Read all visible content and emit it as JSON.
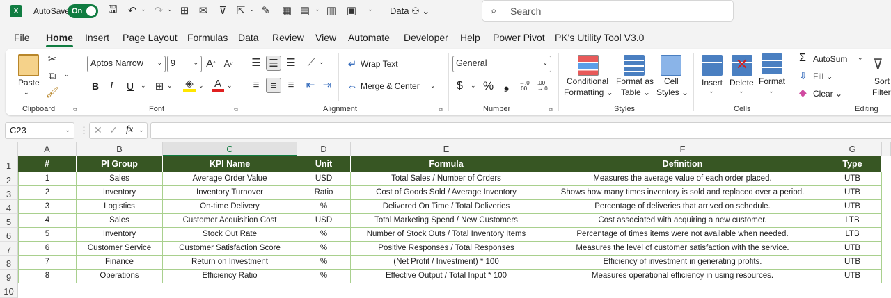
{
  "titlebar": {
    "app_letter": "X",
    "autosave_label": "AutoSave",
    "autosave_state": "On",
    "file_name": "Data",
    "search_placeholder": "Search"
  },
  "menu": {
    "tabs": [
      "File",
      "Home",
      "Insert",
      "Page Layout",
      "Formulas",
      "Data",
      "Review",
      "View",
      "Automate",
      "Developer",
      "Help",
      "Power Pivot",
      "PK's Utility Tool V3.0"
    ],
    "active": "Home"
  },
  "ribbon": {
    "clipboard": {
      "label": "Clipboard",
      "paste": "Paste"
    },
    "font": {
      "label": "Font",
      "font_name": "Aptos Narrow",
      "font_size": "9",
      "bold": "B",
      "italic": "I",
      "underline": "U"
    },
    "alignment": {
      "label": "Alignment",
      "wrap_text": "Wrap Text",
      "merge_center": "Merge & Center"
    },
    "number": {
      "label": "Number",
      "format": "General",
      "currency": "$",
      "percent": "%",
      "comma": "❟",
      "inc_dec": "←.0 .00",
      "dec_dec": ".00 →.0"
    },
    "styles": {
      "label": "Styles",
      "conditional": "Conditional",
      "formatting": "Formatting",
      "format_as": "Format as",
      "table": "Table",
      "cell": "Cell",
      "cell_styles": "Styles"
    },
    "cells": {
      "label": "Cells",
      "insert": "Insert",
      "delete": "Delete",
      "format": "Format"
    },
    "editing": {
      "label": "Editing",
      "autosum": "AutoSum",
      "fill": "Fill",
      "clear": "Clear",
      "sort": "Sort",
      "filter": "Filter"
    }
  },
  "formula_bar": {
    "name_box": "C23",
    "fx": "fx",
    "content": ""
  },
  "sheet": {
    "columns": [
      "A",
      "B",
      "C",
      "D",
      "E",
      "F",
      "G"
    ],
    "selected_column": "C",
    "row_numbers": [
      "1",
      "2",
      "3",
      "4",
      "5",
      "6",
      "7",
      "8",
      "9",
      "10"
    ],
    "headers": [
      "#",
      "PI Group",
      "KPI Name",
      "Unit",
      "Formula",
      "Definition",
      "Type"
    ],
    "rows": [
      [
        "1",
        "Sales",
        "Average Order Value",
        "USD",
        "Total Sales / Number of Orders",
        "Measures the average value of each order placed.",
        "UTB"
      ],
      [
        "2",
        "Inventory",
        "Inventory Turnover",
        "Ratio",
        "Cost of Goods Sold / Average Inventory",
        "Shows how many times inventory is sold and replaced over a period.",
        "UTB"
      ],
      [
        "3",
        "Logistics",
        "On-time Delivery",
        "%",
        "Delivered On Time / Total Deliveries",
        "Percentage of deliveries that arrived on schedule.",
        "UTB"
      ],
      [
        "4",
        "Sales",
        "Customer Acquisition Cost",
        "USD",
        "Total Marketing Spend / New Customers",
        "Cost associated with acquiring a new customer.",
        "LTB"
      ],
      [
        "5",
        "Inventory",
        "Stock Out Rate",
        "%",
        "Number of Stock Outs / Total Inventory Items",
        "Percentage of times items were not available when needed.",
        "LTB"
      ],
      [
        "6",
        "Customer Service",
        "Customer Satisfaction Score",
        "%",
        "Positive Responses / Total Responses",
        "Measures the level of customer satisfaction with the service.",
        "UTB"
      ],
      [
        "7",
        "Finance",
        "Return on Investment",
        "%",
        "(Net Profit / Investment) * 100",
        "Efficiency of investment in generating profits.",
        "UTB"
      ],
      [
        "8",
        "Operations",
        "Efficiency Ratio",
        "%",
        "Effective Output / Total Input * 100",
        "Measures operational efficiency in using resources.",
        "UTB"
      ]
    ]
  },
  "colors": {
    "header_fill": "#375623",
    "cell_border": "#a9d08e",
    "accent": "#107c41"
  }
}
